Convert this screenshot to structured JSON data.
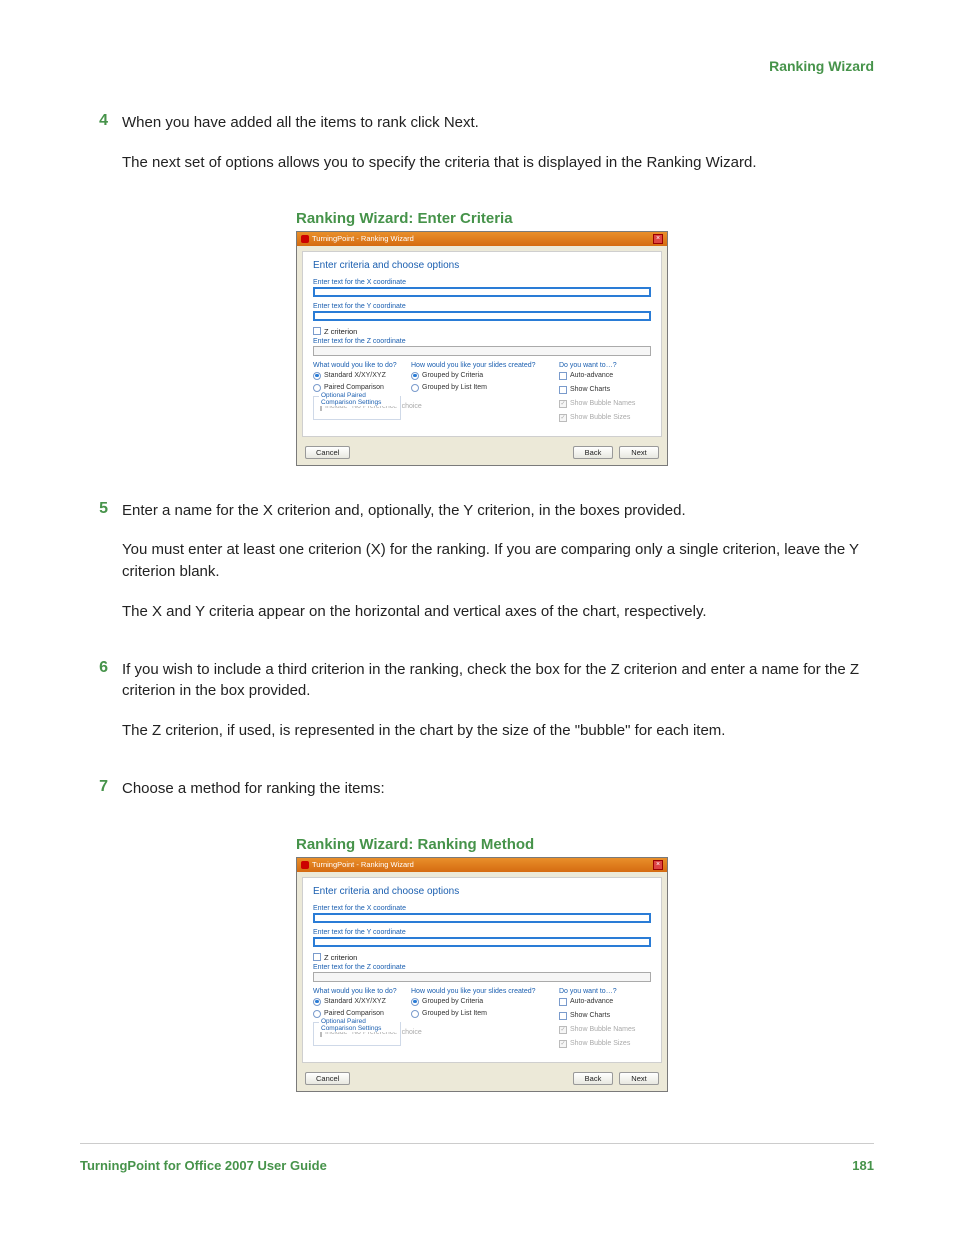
{
  "header": {
    "section": "Ranking Wizard"
  },
  "steps": {
    "s4": {
      "num": "4",
      "p1": "When you have added all the items to rank click Next.",
      "p2": "The next set of options allows you to specify the criteria that is displayed in the Ranking Wizard."
    },
    "s5": {
      "num": "5",
      "p1": "Enter a name for the X criterion and, optionally, the Y criterion, in the boxes provided.",
      "p2": "You must enter at least one criterion (X) for the ranking. If you are comparing only a single criterion, leave the Y criterion blank.",
      "p3": "The X and Y criteria appear on the horizontal and vertical axes of the chart, respectively."
    },
    "s6": {
      "num": "6",
      "p1": "If you wish to include a third criterion in the ranking, check the box for the Z criterion and enter a name for the Z criterion in the box provided.",
      "p2": "The Z criterion, if used, is represented in the chart by the size of the \"bubble\" for each item."
    },
    "s7": {
      "num": "7",
      "p1": "Choose a method for ranking the items:"
    }
  },
  "fig1": {
    "caption": "Ranking Wizard: Enter Criteria"
  },
  "fig2": {
    "caption": "Ranking Wizard: Ranking Method"
  },
  "dialog": {
    "title": "TurningPoint - Ranking Wizard",
    "heading": "Enter criteria and choose options",
    "x_label": "Enter text for the X coordinate",
    "y_label": "Enter text for the Y coordinate",
    "z_check": "Z criterion",
    "z_label": "Enter text for the Z coordinate",
    "g1": {
      "label": "What would you like to do?",
      "o1": "Standard X/XY/XYZ",
      "o2": "Paired Comparison"
    },
    "g2": {
      "label": "How would you like your slides created?",
      "o1": "Grouped by Criteria",
      "o2": "Grouped by List Item"
    },
    "g3": {
      "label": "Do you want to…?",
      "c1": "Auto-advance",
      "c2": "Show Charts",
      "c3": "Show Bubble Names",
      "c4": "Show Bubble Sizes"
    },
    "fieldset": {
      "legend": "Optional Paired Comparison Settings",
      "c1": "Include \"No Preference\" choice"
    },
    "btn_cancel": "Cancel",
    "btn_back": "Back",
    "btn_next": "Next"
  },
  "footer": {
    "left": "TurningPoint for Office 2007 User Guide",
    "right": "181"
  }
}
